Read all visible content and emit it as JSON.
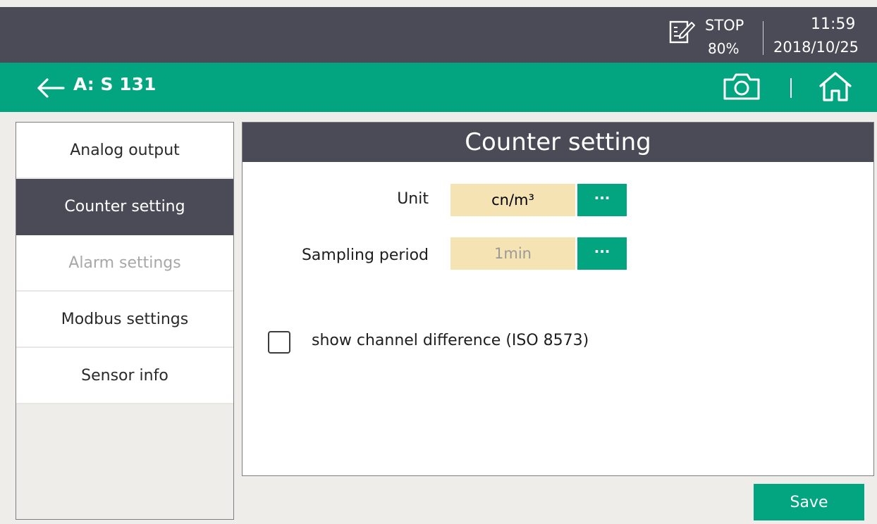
{
  "status": {
    "state": "STOP",
    "battery": "80%",
    "time": "11:59",
    "date": "2018/10/25"
  },
  "titlebar": {
    "title": "A: S 131"
  },
  "menu": {
    "items": [
      {
        "label": "Analog output"
      },
      {
        "label": "Counter setting"
      },
      {
        "label": "Alarm settings"
      },
      {
        "label": "Modbus settings"
      },
      {
        "label": "Sensor info"
      }
    ],
    "active_index": 1
  },
  "panel": {
    "title": "Counter setting",
    "unit": {
      "label": "Unit",
      "value": "cn/m³",
      "button": "···"
    },
    "sampling": {
      "label": "Sampling period",
      "value": "1min",
      "button": "···"
    },
    "checkbox": {
      "label": "show channel difference (ISO 8573)",
      "checked": false
    }
  },
  "footer": {
    "save_label": "Save"
  },
  "colors": {
    "accent": "#03a580",
    "dark": "#4a4b56",
    "value_bg": "#f6e3b3",
    "background": "#efedea"
  },
  "icons": [
    "document-edit-icon",
    "back-arrow-icon",
    "camera-icon",
    "home-icon"
  ]
}
